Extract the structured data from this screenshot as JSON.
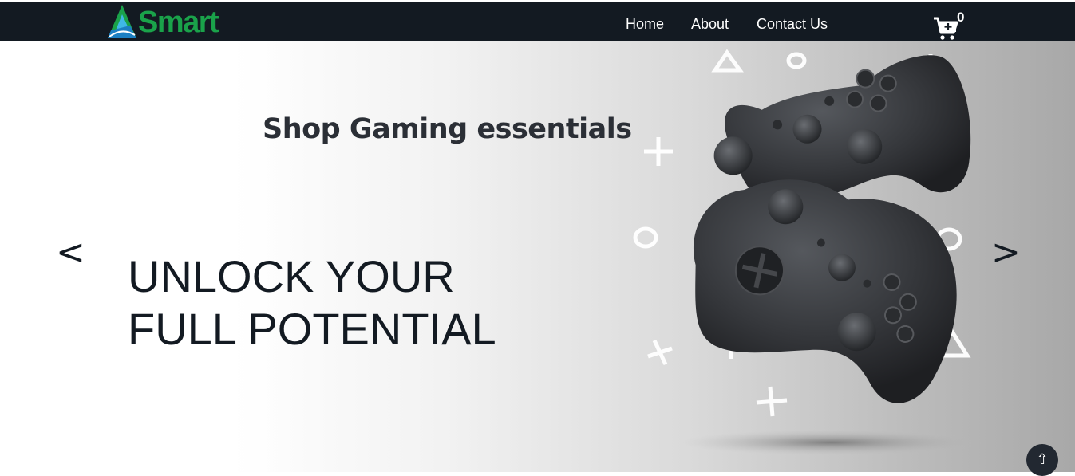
{
  "navbar": {
    "logo_text": "Smart",
    "links": [
      "Home",
      "About",
      "Contact Us"
    ],
    "cart_count": "0",
    "background": "#131a22",
    "logo_color": "#1aa24a"
  },
  "hero": {
    "tagline": "Shop Gaming essentials",
    "headline_line1": "UNLOCK YOUR",
    "headline_line2": "FULL POTENTIAL",
    "prev_label": "<",
    "next_label": ">"
  },
  "scroll_top": {
    "label": "⇧"
  },
  "icons": [
    "smart-logo-icon",
    "cart-icon",
    "gamepad-image",
    "scroll-top-icon"
  ]
}
